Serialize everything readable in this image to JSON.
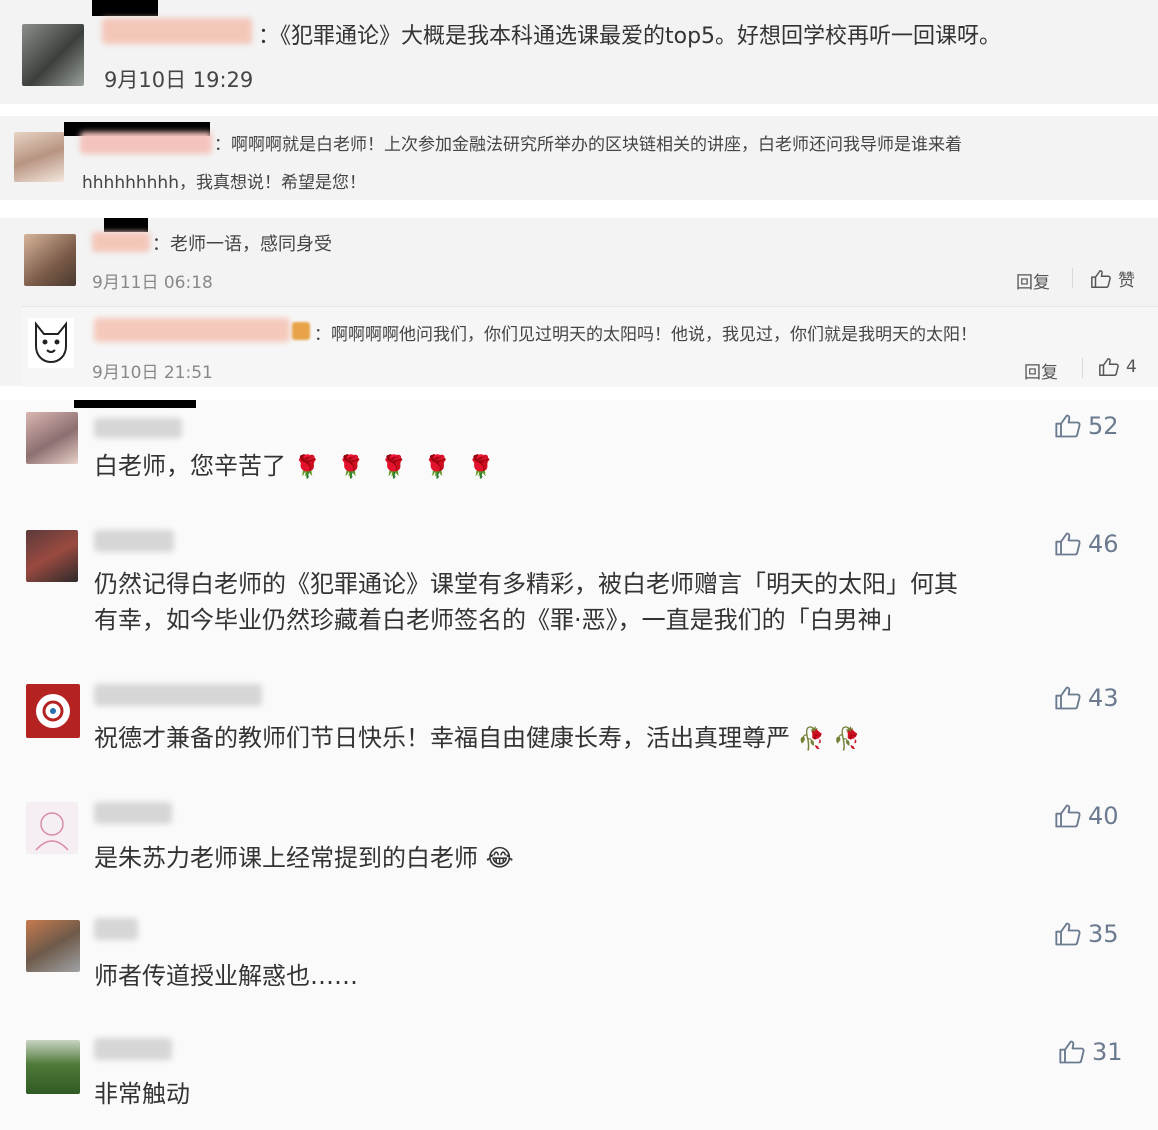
{
  "screenshot1": {
    "text": "：《犯罪通论》大概是我本科通选课最爱的top5。好想回学校再听一回课呀。",
    "time": "9月10日 19:29"
  },
  "screenshot2": {
    "line1": "：啊啊啊就是白老师！上次参加金融法研究所举办的区块链相关的讲座，白老师还问我导师是谁来着",
    "line2": "hhhhhhhhh，我真想说！希望是您！"
  },
  "screenshot3": {
    "comment1": {
      "text": "：老师一语，感同身受",
      "time": "9月11日 06:18",
      "reply": "回复",
      "like_label": "赞"
    },
    "comment2": {
      "text": "：啊啊啊啊他问我们，你们见过明天的太阳吗！他说，我见过，你们就是我明天的太阳！",
      "time": "9月10日 21:51",
      "reply": "回复",
      "likes": "4"
    }
  },
  "comments": [
    {
      "text": "白老师，您辛苦了",
      "likes": "52",
      "emoji": "🌹🌹🌹🌹🌹"
    },
    {
      "line1": "仍然记得白老师的《犯罪通论》课堂有多精彩，被白老师赠言「明天的太阳」何其",
      "line2": "有幸，如今毕业仍然珍藏着白老师签名的《罪·恶》，一直是我们的「白男神」",
      "likes": "46"
    },
    {
      "text": "祝德才兼备的教师们节日快乐！幸福自由健康长寿，活出真理尊严",
      "likes": "43",
      "emoji": "🥀🥀"
    },
    {
      "text": "是朱苏力老师课上经常提到的白老师",
      "likes": "40",
      "emoji": "😂"
    },
    {
      "text": "师者传道授业解惑也……",
      "likes": "35"
    },
    {
      "text": "非常触动",
      "likes": "31"
    }
  ],
  "icons": {
    "thumb": "thumbs-up-icon",
    "rose": "rose-emoji",
    "laugh": "laughing-emoji"
  },
  "colors": {
    "like_blue": "#6b7a8f",
    "rose_red": "#c21a1a",
    "redaction": "#000000"
  }
}
